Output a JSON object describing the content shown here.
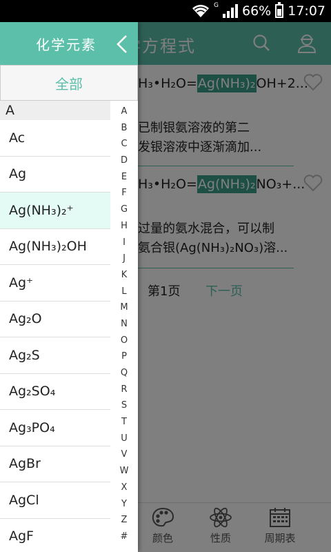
{
  "status_bar": {
    "network": "G",
    "battery": "66%",
    "time": "17:07"
  },
  "background": {
    "title": "学方程式",
    "results": [
      {
        "eq_prefix": "H₃•H₂O=",
        "eq_highlight": "Ag(NH₃)₂",
        "eq_suffix": "OH+2...",
        "desc_line1": "已制银氨溶液的第二",
        "desc_line2": "发银溶液中逐渐滴加..."
      },
      {
        "eq_prefix": "H₃•H₂O=",
        "eq_highlight": "Ag(NH₃)₂",
        "eq_suffix": "NO₃+...",
        "desc_line1": "过量的氨水混合，可以制",
        "desc_line2": "氨合银(Ag(NH₃)₂NO₃)溶..."
      }
    ],
    "pager": {
      "current": "第1页",
      "next": "下一页"
    },
    "bottom_nav": [
      {
        "label": "颜色",
        "icon": "palette-icon"
      },
      {
        "label": "性质",
        "icon": "atom-icon"
      },
      {
        "label": "周期表",
        "icon": "calendar-icon"
      }
    ]
  },
  "drawer": {
    "title": "化学元素",
    "all_tab": "全部",
    "section": "A",
    "items": [
      "Ac",
      "Ag",
      "Ag(NH₃)₂⁺",
      "Ag(NH₃)₂OH",
      "Ag⁺",
      "Ag₂O",
      "Ag₂S",
      "Ag₂SO₄",
      "Ag₃PO₄",
      "AgBr",
      "AgCl",
      "AgF"
    ],
    "selected_index": 2,
    "index_letters": [
      "A",
      "B",
      "C",
      "D",
      "E",
      "F",
      "G",
      "H",
      "I",
      "J",
      "K",
      "L",
      "M",
      "N",
      "O",
      "P",
      "Q",
      "R",
      "S",
      "T",
      "U",
      "V",
      "W",
      "X",
      "Y",
      "Z",
      "#"
    ]
  },
  "colors": {
    "accent": "#5bbfa9",
    "highlight": "#3b9f8a",
    "selected_row": "#e4faf5"
  }
}
